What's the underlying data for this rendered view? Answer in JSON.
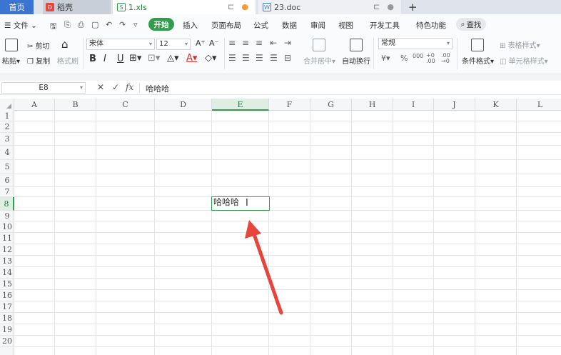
{
  "tabs": {
    "home": "首页",
    "daoke": "稻壳",
    "xls": "1.xls",
    "doc": "23.doc",
    "daoke_icon_letter": "D",
    "xls_icon_letter": "S",
    "doc_icon_letter": "W"
  },
  "menu": {
    "file": "文件",
    "start": "开始",
    "insert": "插入",
    "page_layout": "页面布局",
    "formula": "公式",
    "data": "数据",
    "review": "审阅",
    "view": "视图",
    "dev_tools": "开发工具",
    "special": "特色功能",
    "search": "查找"
  },
  "ribbon": {
    "paste": "粘贴",
    "cut": "剪切",
    "copy": "复制",
    "format_painter": "格式刷",
    "font_name": "宋体",
    "font_size": "12",
    "font_grow": "A⁺",
    "font_shrink": "A⁻",
    "bold": "B",
    "italic": "I",
    "underline": "U",
    "merge_center": "合并居中",
    "wrap_text": "自动换行",
    "number_format": "常规",
    "currency": "¥",
    "percent": "%",
    "thousands": "000",
    "inc_decimal": "+0 .00",
    "dec_decimal": ".00 →0",
    "cond_format": "条件格式",
    "table_style": "表格样式",
    "cell_style": "单元格样式"
  },
  "formula_bar": {
    "cell_ref": "E8",
    "content": "哈哈哈",
    "fx": "fx",
    "cancel": "✕",
    "confirm": "✓"
  },
  "sheet": {
    "columns": [
      "A",
      "B",
      "C",
      "D",
      "E",
      "F",
      "G",
      "H",
      "I",
      "J",
      "K",
      "L"
    ],
    "rows": [
      "1",
      "2",
      "3",
      "4",
      "5",
      "6",
      "7",
      "8",
      "9",
      "10",
      "11",
      "12",
      "13",
      "14",
      "15",
      "16",
      "17",
      "18",
      "19",
      "20"
    ],
    "active_column": "E",
    "active_row": "8",
    "active_cell_text": "哈哈哈"
  },
  "colors": {
    "accent_green": "#2f9d4a",
    "tab_blue": "#3b74d1",
    "arrow_red": "#e8453c"
  }
}
